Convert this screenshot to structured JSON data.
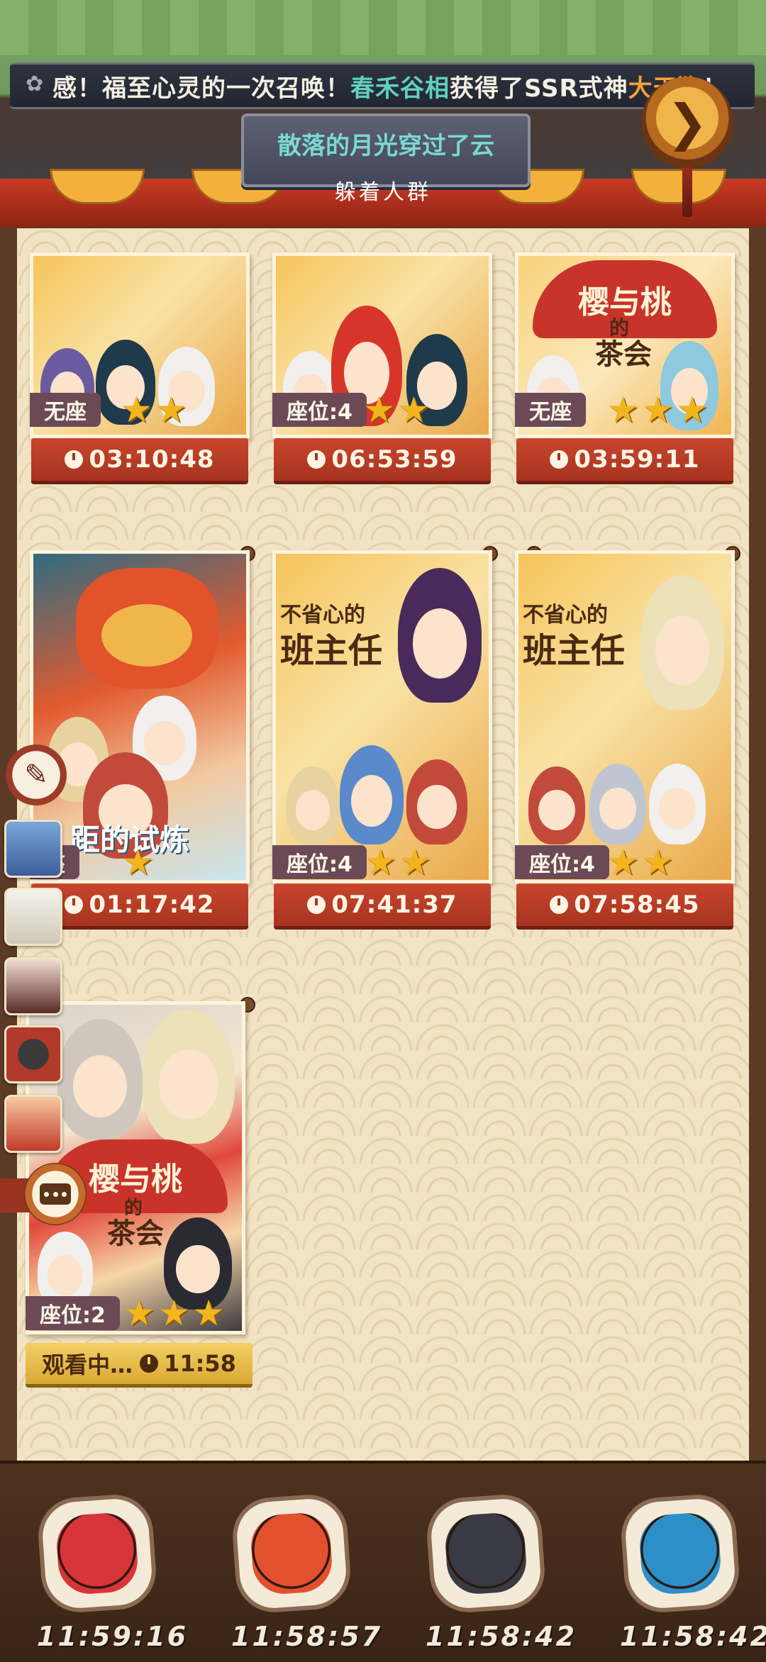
{
  "announcement": {
    "prefix": "感！福至心灵的一次召唤！",
    "player": "春禾谷相",
    "middle": "获得了SSR式神",
    "shikigami": "大天狗",
    "suffix": "！"
  },
  "status": {
    "title": "散落的月光穿过了云",
    "subtitle": "躲着人群"
  },
  "rooms": [
    {
      "seat": "无座",
      "stars": 2,
      "timer": "03:10:48"
    },
    {
      "seat": "座位:4",
      "stars": 2,
      "timer": "06:53:59"
    },
    {
      "seat": "无座",
      "stars": 3,
      "timer": "03:59:11",
      "art_title_top": "樱与桃",
      "art_title_mid": "的",
      "art_title_bot": "茶会"
    },
    {
      "seat": "座",
      "stars": 1,
      "timer": "01:17:42",
      "art_banner": "距的试炼"
    },
    {
      "seat": "座位:4",
      "stars": 2,
      "timer": "07:41:37",
      "art_title_top": "不省心的",
      "art_title_bot": "班主任"
    },
    {
      "seat": "座位:4",
      "stars": 2,
      "timer": "07:58:45",
      "art_title_top": "不省心的",
      "art_title_bot": "班主任"
    },
    {
      "seat": "座位:2",
      "stars": 3,
      "watching_label": "观看中…",
      "timer": "11:58",
      "art_title_top": "樱与桃",
      "art_title_mid": "的",
      "art_title_bot": "茶会"
    }
  ],
  "bottom_slots": [
    {
      "timer": "11:59:16",
      "icon": "red-oni-ghost-icon",
      "color": "#d8353a"
    },
    {
      "timer": "11:58:57",
      "icon": "fire-oni-ghost-icon",
      "color": "#e2502d"
    },
    {
      "timer": "11:58:42",
      "icon": "black-mask-ghost-icon",
      "color": "#3a3a44"
    },
    {
      "timer": "11:58:42",
      "icon": "blue-face-ghost-icon",
      "color": "#2d8fc8"
    }
  ],
  "colors": {
    "timer_red": "#a63420",
    "watching_gold": "#d9a933",
    "seat_tag": "#6b4a56",
    "ticker_green": "#5fd1c1",
    "ticker_orange": "#f2a23a"
  }
}
